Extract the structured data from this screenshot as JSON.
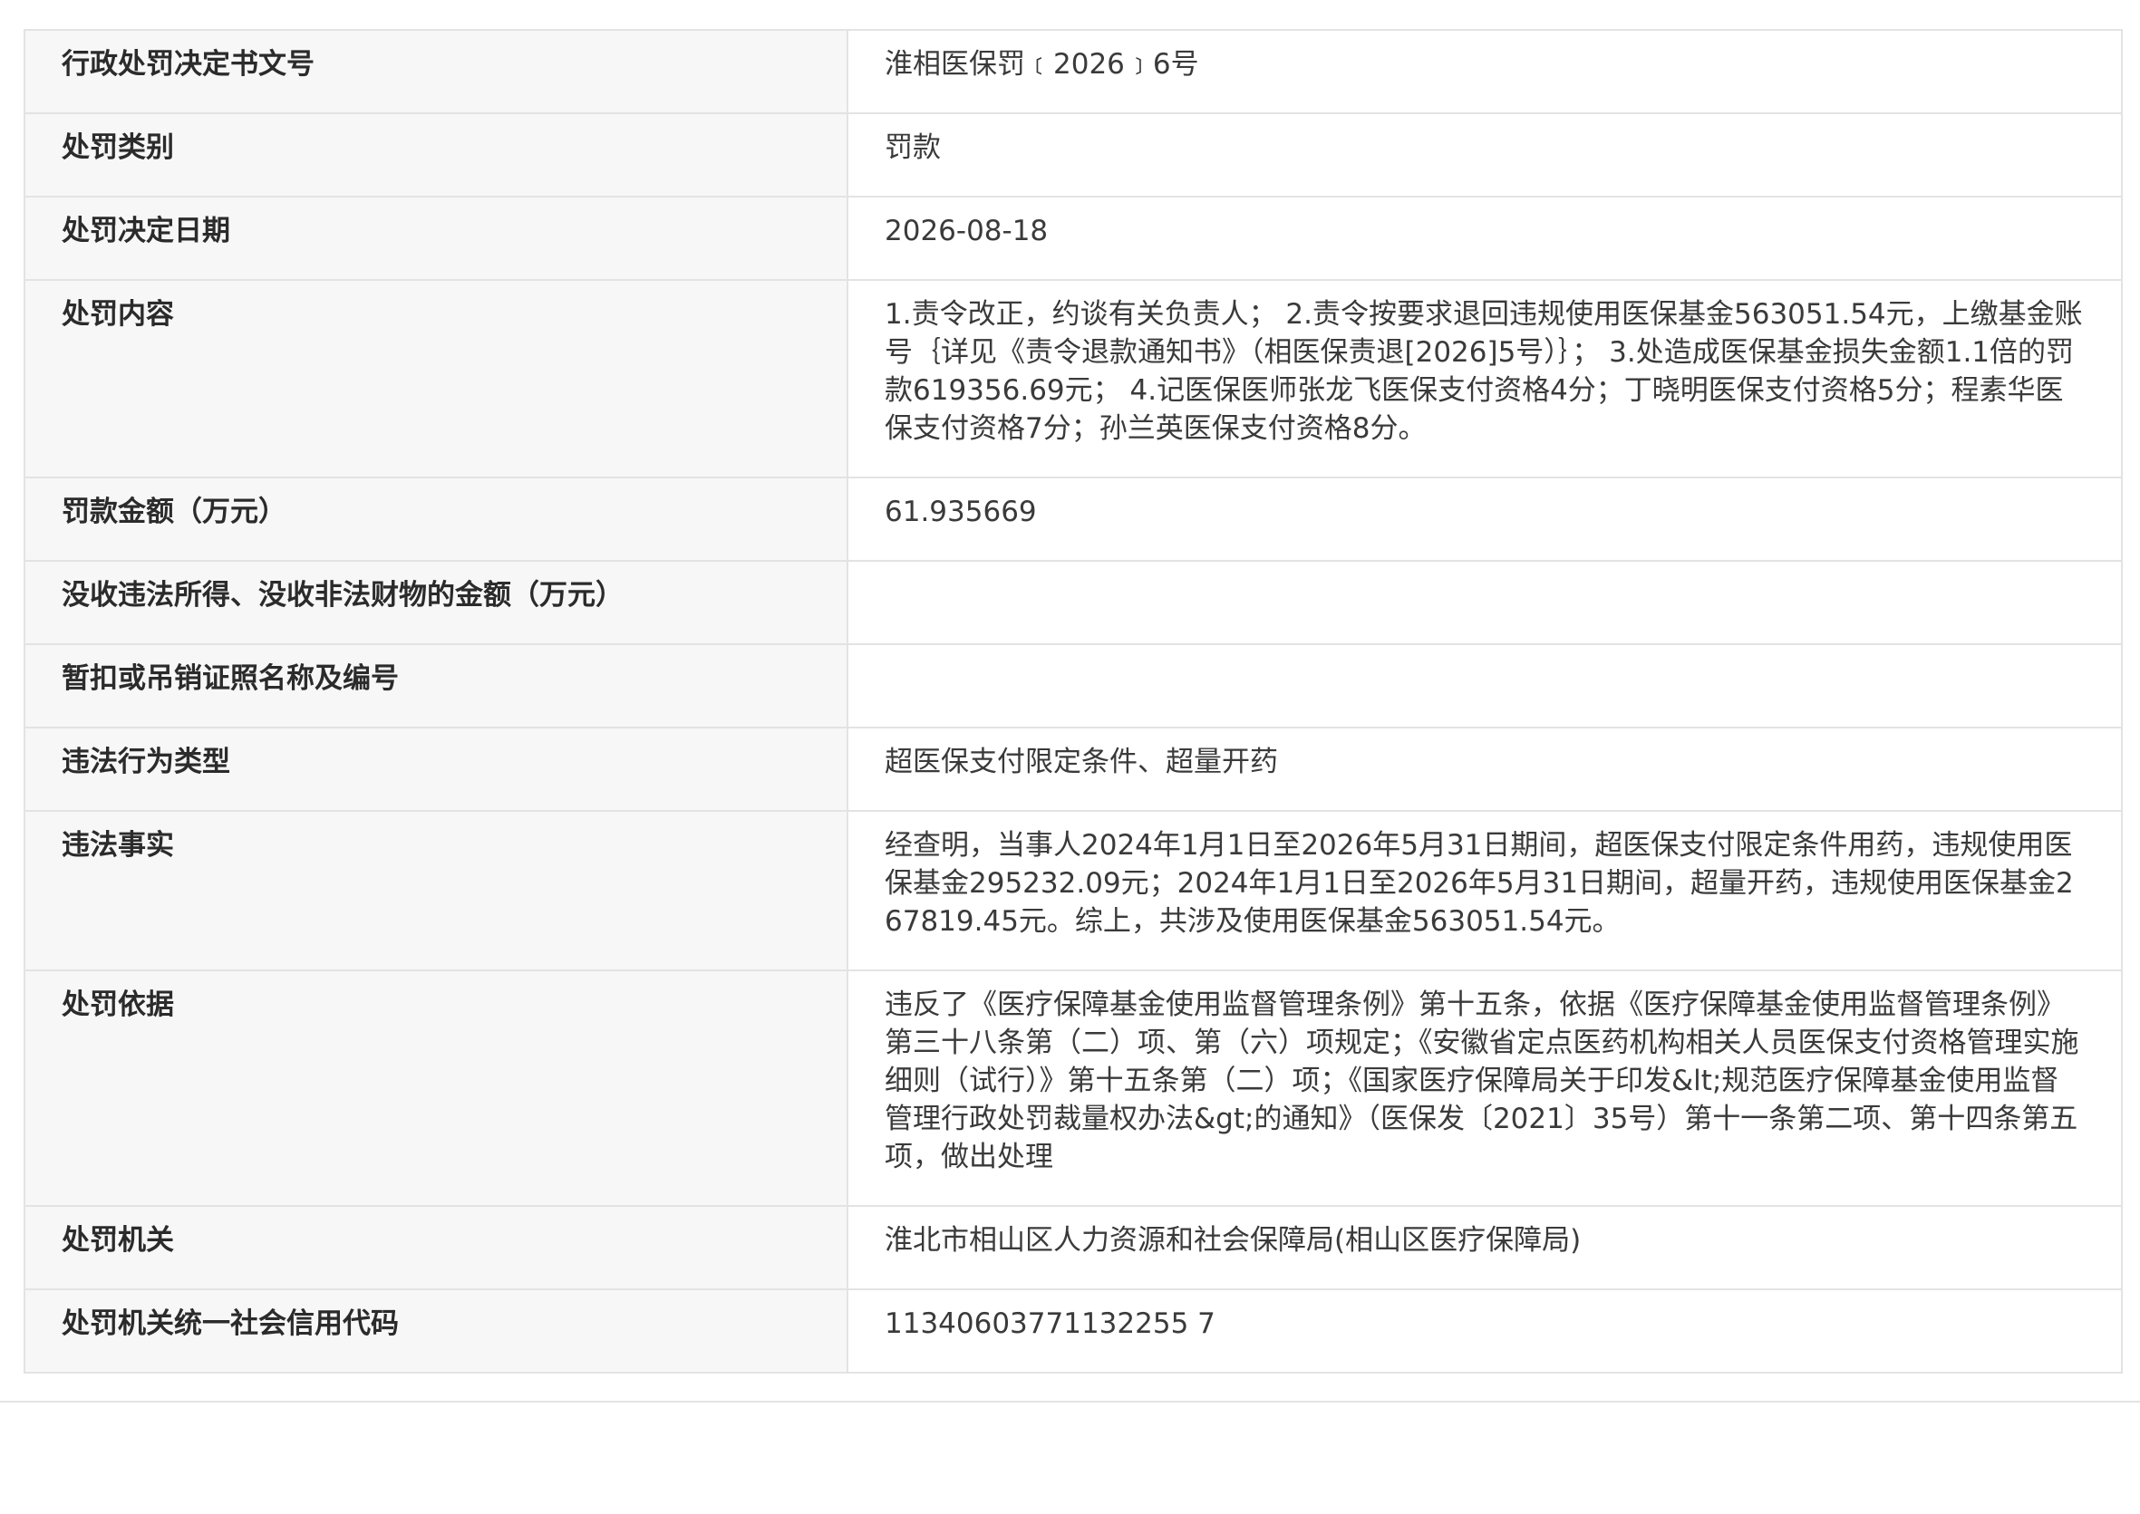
{
  "rows": [
    {
      "label": "行政处罚决定书文号",
      "value": "淮相医保罚﹝2026﹞6号"
    },
    {
      "label": "处罚类别",
      "value": "罚款"
    },
    {
      "label": "处罚决定日期",
      "value": "2026-08-18"
    },
    {
      "label": "处罚内容",
      "value": "1.责令改正，约谈有关负责人； 2.责令按要求退回违规使用医保基金563051.54元，上缴基金账号｛详见《责令退款通知书》（相医保责退[2026]5号）｝； 3.处造成医保基金损失金额1.1倍的罚款619356.69元； 4.记医保医师张龙飞医保支付资格4分；丁晓明医保支付资格5分；程素华医保支付资格7分；孙兰英医保支付资格8分。"
    },
    {
      "label": "罚款金额（万元）",
      "value": "61.935669"
    },
    {
      "label": "没收违法所得、没收非法财物的金额（万元）",
      "value": ""
    },
    {
      "label": "暂扣或吊销证照名称及编号",
      "value": ""
    },
    {
      "label": "违法行为类型",
      "value": "超医保支付限定条件、超量开药"
    },
    {
      "label": "违法事实",
      "value": "经查明，当事人2024年1月1日至2026年5月31日期间，超医保支付限定条件用药，违规使用医保基金295232.09元；2024年1月1日至2026年5月31日期间，超量开药，违规使用医保基金267819.45元。综上，共涉及使用医保基金563051.54元。"
    },
    {
      "label": "处罚依据",
      "value": "违反了《医疗保障基金使用监督管理条例》第十五条，依据《医疗保障基金使用监督管理条例》第三十八条第（二）项、第（六）项规定；《安徽省定点医药机构相关人员医保支付资格管理实施细则（试行）》第十五条第（二）项；《国家医疗保障局关于印发&lt;规范医疗保障基金使用监督管理行政处罚裁量权办法&gt;的通知》（医保发〔2021〕35号）第十一条第二项、第十四条第五项，做出处理"
    },
    {
      "label": "处罚机关",
      "value": "淮北市相山区人力资源和社会保障局(相山区医疗保障局)"
    },
    {
      "label": "处罚机关统一社会信用代码",
      "value": "11340603771132255 7"
    }
  ]
}
